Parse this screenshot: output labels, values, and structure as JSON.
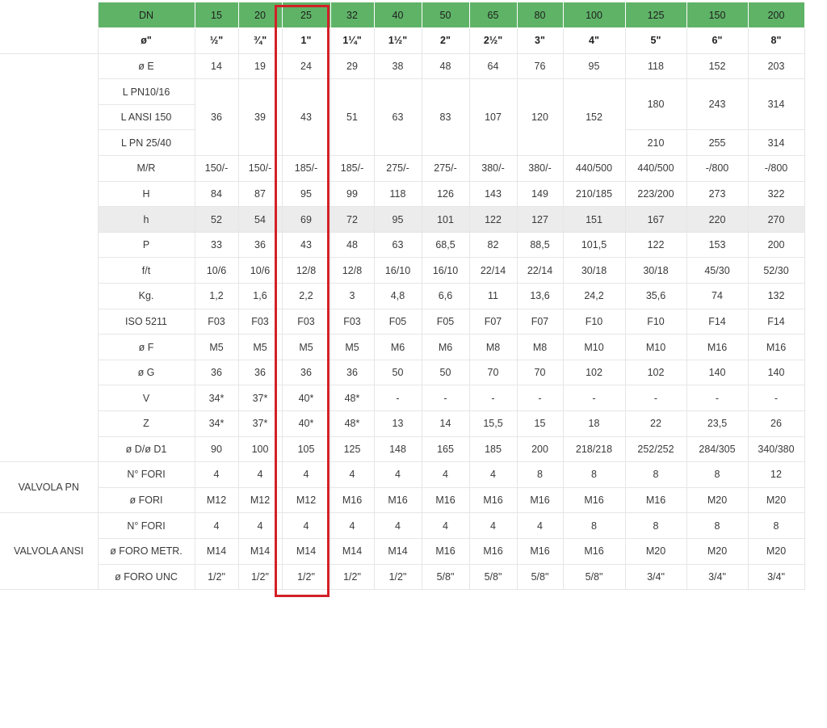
{
  "dn_label": "DN",
  "dn_values": [
    "15",
    "20",
    "25",
    "32",
    "40",
    "50",
    "65",
    "80",
    "100",
    "125",
    "150",
    "200"
  ],
  "inch_label": "ø\"",
  "inch_values": [
    "½\"",
    "¾\"",
    "1\"",
    "1¼\"",
    "1½\"",
    "2\"",
    "2½\"",
    "3\"",
    "4\"",
    "5\"",
    "6\"",
    "8\""
  ],
  "e_row": {
    "label": "ø E",
    "values": [
      "14",
      "19",
      "24",
      "29",
      "38",
      "48",
      "64",
      "76",
      "95",
      "118",
      "152",
      "203"
    ]
  },
  "l_labels": [
    "L PN10/16",
    "L ANSI 150",
    "L PN 25/40"
  ],
  "l_common": [
    "36",
    "39",
    "43",
    "51",
    "63",
    "83",
    "107",
    "120",
    "152"
  ],
  "l_top": [
    "180",
    "243",
    "314"
  ],
  "l_bottom": [
    "210",
    "255",
    "314"
  ],
  "rows": [
    {
      "label": "M/R",
      "values": [
        "150/-",
        "150/-",
        "185/-",
        "185/-",
        "275/-",
        "275/-",
        "380/-",
        "380/-",
        "440/500",
        "440/500",
        "-/800",
        "-/800"
      ]
    },
    {
      "label": "H",
      "values": [
        "84",
        "87",
        "95",
        "99",
        "118",
        "126",
        "143",
        "149",
        "210/185",
        "223/200",
        "273",
        "322"
      ]
    },
    {
      "label": "h",
      "values": [
        "52",
        "54",
        "69",
        "72",
        "95",
        "101",
        "122",
        "127",
        "151",
        "167",
        "220",
        "270"
      ]
    },
    {
      "label": "P",
      "values": [
        "33",
        "36",
        "43",
        "48",
        "63",
        "68,5",
        "82",
        "88,5",
        "101,5",
        "122",
        "153",
        "200"
      ]
    },
    {
      "label": "f/t",
      "values": [
        "10/6",
        "10/6",
        "12/8",
        "12/8",
        "16/10",
        "16/10",
        "22/14",
        "22/14",
        "30/18",
        "30/18",
        "45/30",
        "52/30"
      ]
    },
    {
      "label": "Kg.",
      "values": [
        "1,2",
        "1,6",
        "2,2",
        "3",
        "4,8",
        "6,6",
        "11",
        "13,6",
        "24,2",
        "35,6",
        "74",
        "132"
      ]
    },
    {
      "label": "ISO 5211",
      "values": [
        "F03",
        "F03",
        "F03",
        "F03",
        "F05",
        "F05",
        "F07",
        "F07",
        "F10",
        "F10",
        "F14",
        "F14"
      ]
    },
    {
      "label": "ø F",
      "values": [
        "M5",
        "M5",
        "M5",
        "M5",
        "M6",
        "M6",
        "M8",
        "M8",
        "M10",
        "M10",
        "M16",
        "M16"
      ]
    },
    {
      "label": "ø G",
      "values": [
        "36",
        "36",
        "36",
        "36",
        "50",
        "50",
        "70",
        "70",
        "102",
        "102",
        "140",
        "140"
      ]
    },
    {
      "label": "V",
      "values": [
        "34*",
        "37*",
        "40*",
        "48*",
        "-",
        "-",
        "-",
        "-",
        "-",
        "-",
        "-",
        "-"
      ]
    },
    {
      "label": "Z",
      "values": [
        "34*",
        "37*",
        "40*",
        "48*",
        "13",
        "14",
        "15,5",
        "15",
        "18",
        "22",
        "23,5",
        "26"
      ]
    },
    {
      "label": "ø D/ø D1",
      "values": [
        "90",
        "100",
        "105",
        "125",
        "148",
        "165",
        "185",
        "200",
        "218/218",
        "252/252",
        "284/305",
        "340/380"
      ]
    }
  ],
  "groups": [
    {
      "name": "VALVOLA PN",
      "rows": [
        {
          "label": "N° FORI",
          "values": [
            "4",
            "4",
            "4",
            "4",
            "4",
            "4",
            "4",
            "8",
            "8",
            "8",
            "8",
            "12"
          ]
        },
        {
          "label": "ø FORI",
          "values": [
            "M12",
            "M12",
            "M12",
            "M16",
            "M16",
            "M16",
            "M16",
            "M16",
            "M16",
            "M16",
            "M20",
            "M20"
          ]
        }
      ]
    },
    {
      "name": "VALVOLA ANSI",
      "rows": [
        {
          "label": "N° FORI",
          "values": [
            "4",
            "4",
            "4",
            "4",
            "4",
            "4",
            "4",
            "4",
            "8",
            "8",
            "8",
            "8"
          ]
        },
        {
          "label": "ø FORO METR.",
          "values": [
            "M14",
            "M14",
            "M14",
            "M14",
            "M14",
            "M16",
            "M16",
            "M16",
            "M16",
            "M20",
            "M20",
            "M20"
          ]
        },
        {
          "label": "ø FORO UNC",
          "values": [
            "1/2\"",
            "1/2\"",
            "1/2\"",
            "1/2\"",
            "1/2\"",
            "5/8\"",
            "5/8\"",
            "5/8\"",
            "5/8\"",
            "3/4\"",
            "3/4\"",
            "3/4\""
          ]
        }
      ]
    }
  ],
  "highlight": {
    "column_dn": "25",
    "color": "#d32027"
  },
  "header_color": "#5fb367"
}
